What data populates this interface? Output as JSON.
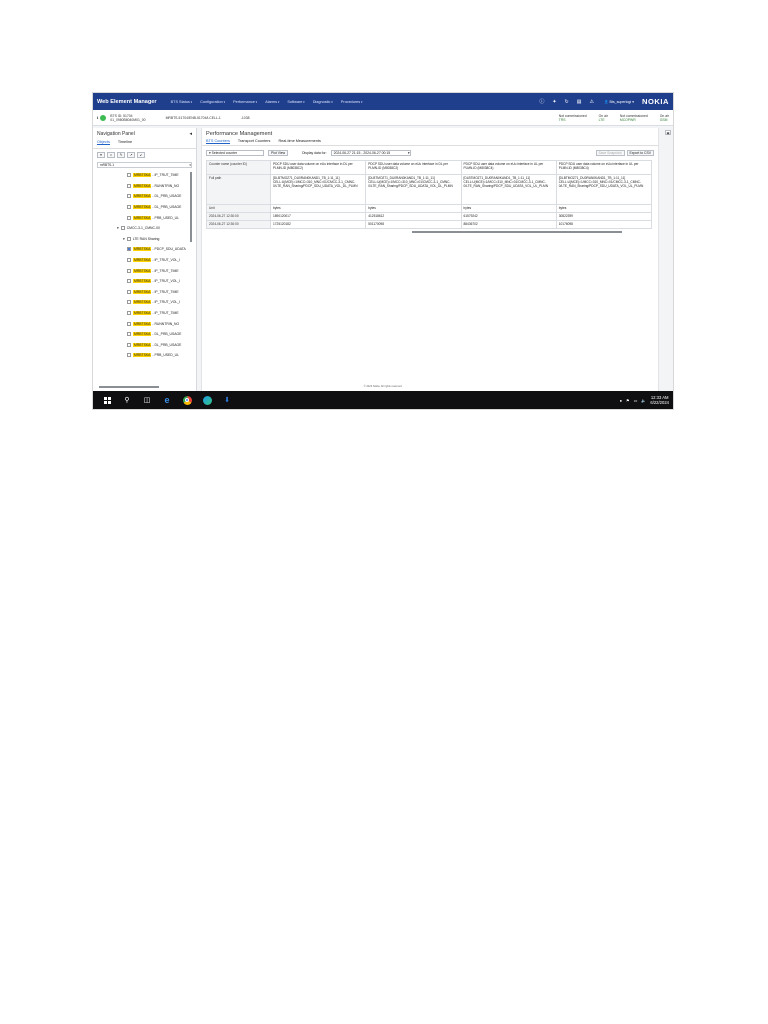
{
  "app": {
    "title": "Web Element Manager",
    "menus": [
      "BTS Status",
      "Configuration",
      "Performance",
      "Alarms",
      "Software",
      "Diagnostic",
      "Procedures"
    ],
    "user": "Bts_superlogi",
    "brand": "NOKIA",
    "top_icons": [
      "info-icon",
      "tools-icon",
      "refresh-icon",
      "chart-icon",
      "warning-icon"
    ]
  },
  "status": {
    "bts_id": "BTS ID: 51704",
    "bts_name": "01_0980B8040M01_00",
    "conn_path": "MRBTS-51704/ENB-51704/LCELL-1",
    "hops": "-1038",
    "groups": [
      {
        "label": "Not commissioned",
        "value": "TRS"
      },
      {
        "label": "On air",
        "value": "LTE"
      },
      {
        "label": "Not commissioned",
        "value": "MCOPWR"
      },
      {
        "label": "On air",
        "value": "GSM"
      }
    ]
  },
  "nav": {
    "title": "Navigation Panel",
    "tabs": [
      "Objects",
      "Timeline"
    ],
    "filter": "mRBTS-1",
    "items": [
      {
        "tag": "MRBTSKA",
        "text": "- IP_TRUT_TIME",
        "checked": false
      },
      {
        "tag": "MRBTSKA",
        "text": "- RUNNTRIN_NO",
        "checked": false
      },
      {
        "tag": "MRBTSKA",
        "text": "- DL_PRB_USAGE",
        "checked": false
      },
      {
        "tag": "MRBTSKA",
        "text": "- DL_PRB_USAGE",
        "checked": false
      },
      {
        "tag": "MRBTSKA",
        "text": "- PRB_USED_UL",
        "checked": false
      },
      {
        "tag": "",
        "text": "CMCC-3-1_CMNC-00",
        "checked": false
      },
      {
        "tag": "",
        "text": "LTE RAN Sharing",
        "checked": false
      },
      {
        "tag": "MRBTSKA",
        "text": "- PDCP_SDU_UDATA",
        "checked": true
      },
      {
        "tag": "MRBTSKA",
        "text": "- IP_TRUT_VOL_I",
        "checked": false
      },
      {
        "tag": "MRBTSKA",
        "text": "- IP_TRUT_TIME",
        "checked": false
      },
      {
        "tag": "MRBTSKA",
        "text": "- IP_TRUT_VOL_I",
        "checked": false
      },
      {
        "tag": "MRBTSKA",
        "text": "- IP_TRUT_TIME",
        "checked": false
      },
      {
        "tag": "MRBTSKA",
        "text": "- IP_TRUT_VOL_I",
        "checked": false
      },
      {
        "tag": "MRBTSKA",
        "text": "- IP_TRUT_TIME",
        "checked": false
      },
      {
        "tag": "MRBTSKA",
        "text": "- RUNNTRIN_NO",
        "checked": false
      },
      {
        "tag": "MRBTSKA",
        "text": "- DL_PRB_USAGE",
        "checked": false
      },
      {
        "tag": "MRBTSKA",
        "text": "- DL_PRB_USAGE",
        "checked": false
      },
      {
        "tag": "MRBTSKA",
        "text": "- PRB_USED_UL",
        "checked": false
      }
    ]
  },
  "main": {
    "title": "Performance Management",
    "tabs": [
      "BTS Counters",
      "Transport Counters",
      "Real-time Measurements"
    ],
    "selected_counter": "Selected counter",
    "plot_view": "Plot View",
    "display_label": "Display data for:",
    "date_range": "2024-06-27 21:15 - 2024-06-27 00:15",
    "export_snapshot": "Save Snapshot",
    "export_csv": "Export to CSV",
    "table": {
      "row_labels": [
        "Counter name (counter ID)",
        "Full path",
        "Unit",
        "2024-06-27 12:30:00",
        "2024-06-27 12:30:00"
      ],
      "columns": [
        {
          "name": "PDCP SDU user data volume on eUu interface in DL per PLMN-ID (M8038C2)",
          "path": "[DLBTMOZ71_DU0RAN0KAND1_TB_1:11_11] CELL:U(MCE)=1/MCC=310_MNC=01/CMCC-3-1_CMNC-0/LTE_RAN_Sharing/PDCP_SDU_UDATA_VOL_DL_PLMN",
          "unit": "bytes",
          "values": [
            "1890120017",
            "1725120182"
          ]
        },
        {
          "name": "PDCP SDU user data volume on eUu interface in DL per PLMN-ID (M8038C2)",
          "path": "[DLBTMOZ71_DU0RAN0KAND1_TB_1:11_11] CELL:U(MCE)=1/MCC=310_MNC=01/CMCC-3-1_CMNC-0/LTE_RAN_Sharing/PDCP_SDU_UDATA_VOL_DL_PLMN",
          "unit": "bytes",
          "values": [
            "412518612",
            "501170098"
          ]
        },
        {
          "name": "PDCP SDU user data volume on eUu interface in UL per PLMN-ID (M8038C4)",
          "path": "[DLBTMOZ71_DU0RAN0KAND1_TB_1:11_11] CELL:U(MCE)=1/MCC=310_MNC=01/CMCC-3-1_CMNC-0/LTE_RAN_Sharing/PDCP_SDU_UDATA_VOL_UL_PLMN",
          "unit": "bytes",
          "values": [
            "61579242",
            "88436702"
          ]
        },
        {
          "name": "PDCP SDU user data volume on eUu interface in UL per PLMN-ID (M8038C4)",
          "path": "[DLBTMOZ71_DU0RAN0KAND1_TB_1:11_11] CELL:U(MCE)=1/MCC=310_MNC=01/CMCC-3-1_CMNC-0/LTE_RAN_Sharing/PDCP_SDU_UDATA_VOL_UL_PLMN",
          "unit": "bytes",
          "values": [
            "30822399",
            "10176098"
          ]
        }
      ]
    }
  },
  "footer": "© 2023 Nokia. All rights reserved.",
  "taskbar": {
    "time": "12:33 AM",
    "date": "6/22/2024"
  }
}
